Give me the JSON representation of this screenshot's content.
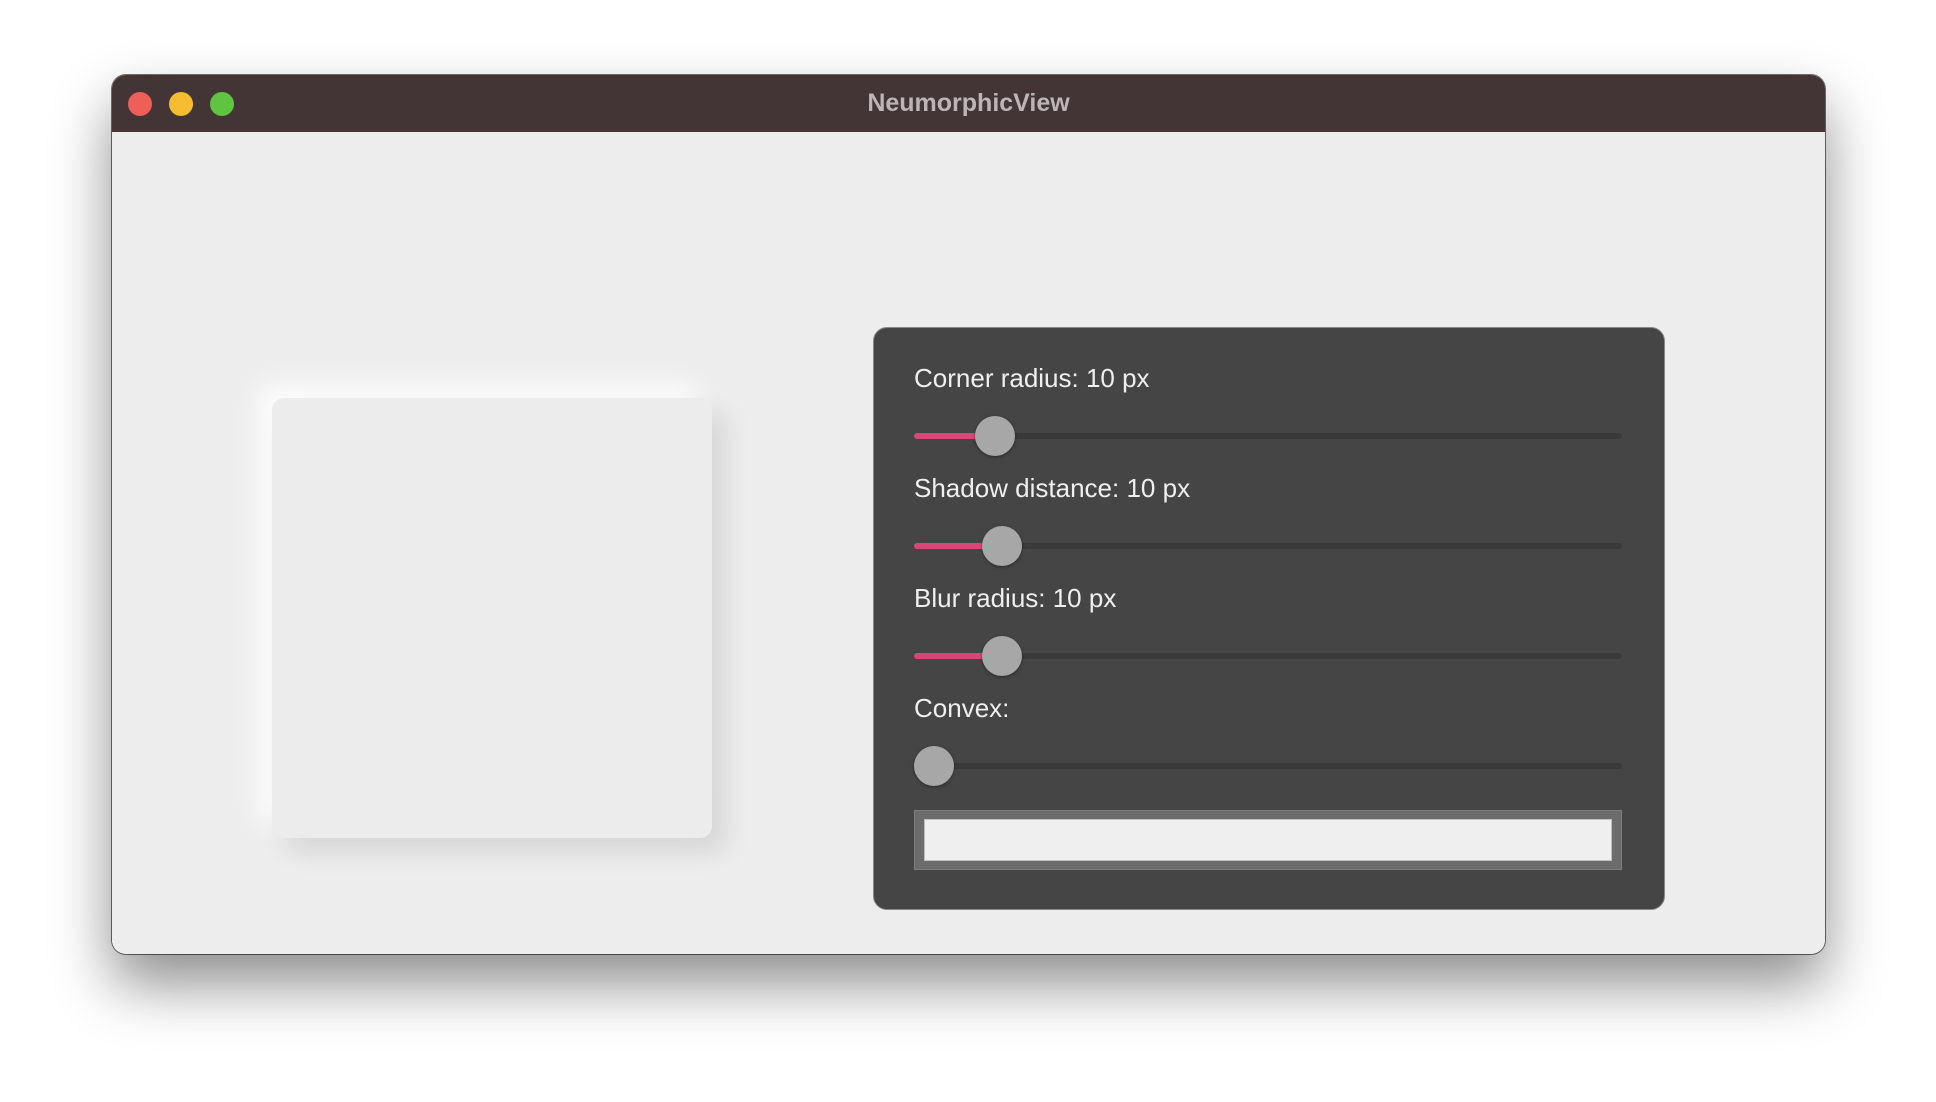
{
  "window": {
    "title": "NeumorphicView"
  },
  "controls": {
    "corner_radius": {
      "label": "Corner radius: 10 px",
      "value": 10,
      "fraction": 0.114
    },
    "shadow_distance": {
      "label": "Shadow distance: 10 px",
      "value": 10,
      "fraction": 0.124
    },
    "blur_radius": {
      "label": "Blur radius: 10 px",
      "value": 10,
      "fraction": 0.124
    },
    "convex": {
      "label": "Convex:",
      "fraction": 0.028
    }
  },
  "colors": {
    "accent": "#d94678",
    "panel_bg": "#454545",
    "window_bg": "#ededed",
    "swatch": "#efefef"
  },
  "icons": {
    "close": "close-icon",
    "minimize": "minimize-icon",
    "maximize": "maximize-icon"
  }
}
